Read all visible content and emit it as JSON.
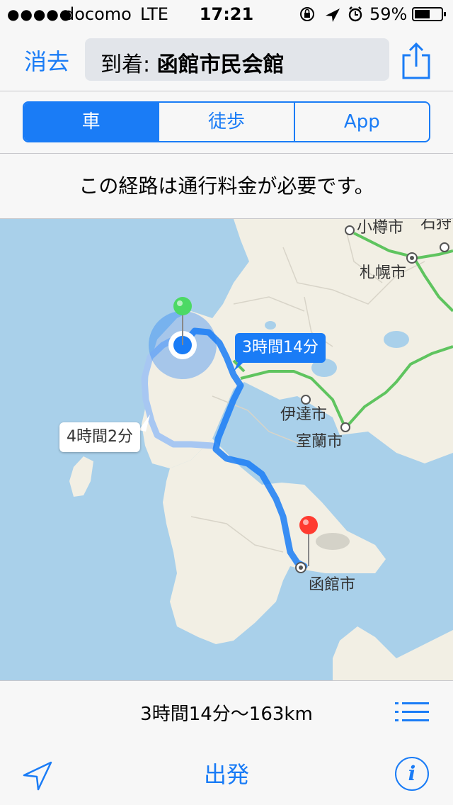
{
  "status_bar": {
    "signal": "●●●●●",
    "carrier": "docomo",
    "network": "LTE",
    "time": "17:21",
    "battery_percent": "59%",
    "battery_level": 0.59,
    "icons": [
      "rotation-lock-icon",
      "location-arrow-icon",
      "alarm-icon",
      "battery-icon"
    ]
  },
  "navbar": {
    "clear_label": "消去",
    "destination_prefix": "到着: ",
    "destination_name": "函館市民会館",
    "share_icon": "share-icon"
  },
  "transport_modes": [
    {
      "label": "車",
      "selected": true
    },
    {
      "label": "徒歩",
      "selected": false
    },
    {
      "label": "App",
      "selected": false
    }
  ],
  "notice": "この経路は通行料金が必要です。",
  "map": {
    "route_primary_time": "3時間14分",
    "route_alt_time": "4時間2分",
    "labels": {
      "otaru": "小樽市",
      "sapporo": "札幌市",
      "date": "伊達市",
      "muroran": "室蘭市",
      "hakodate": "函館市",
      "ishikari": "石狩"
    },
    "colors": {
      "water": "#a9d0ea",
      "land": "#f2efe4",
      "route": "#1a7cf6",
      "highway": "#5fc45f",
      "start_pin": "#4cd964",
      "end_pin": "#ff3b30"
    }
  },
  "summary": {
    "text": "3時間14分〜163km",
    "list_icon": "list-icon"
  },
  "toolbar": {
    "start_label": "出発",
    "locate_icon": "location-arrow-icon",
    "info_label": "i"
  }
}
